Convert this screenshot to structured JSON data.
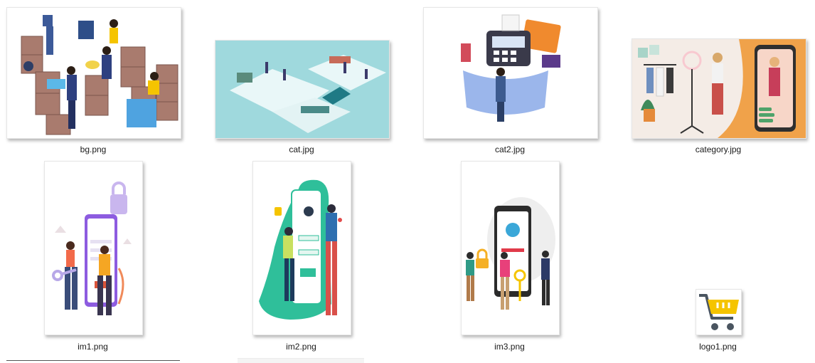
{
  "files": [
    {
      "name": "bg.png",
      "icon": "warehouse-isometric-illustration"
    },
    {
      "name": "cat.jpg",
      "icon": "isometric-store-illustration"
    },
    {
      "name": "cat2.jpg",
      "icon": "pos-payment-terminal-illustration"
    },
    {
      "name": "category.jpg",
      "icon": "fashion-livestream-illustration"
    },
    {
      "name": "im1.png",
      "icon": "phone-login-lock-illustration"
    },
    {
      "name": "im2.png",
      "icon": "phone-signin-people-illustration"
    },
    {
      "name": "im3.png",
      "icon": "phone-password-lock-illustration"
    },
    {
      "name": "logo1.png",
      "icon": "shopping-cart-logo"
    }
  ],
  "colors": {
    "accent": "#f5c400",
    "cart_wheels": "#4a5560"
  }
}
